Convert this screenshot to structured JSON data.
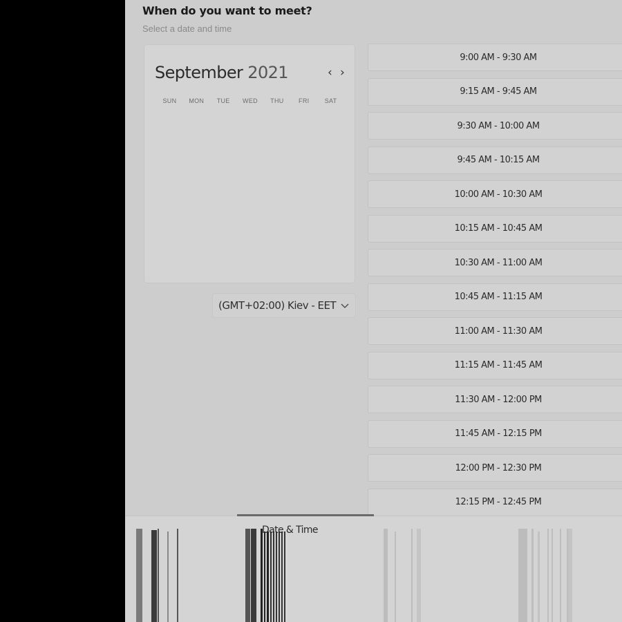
{
  "header": {
    "title": "When do you want to meet?",
    "subtitle": "Select a date and time"
  },
  "calendar": {
    "month": "September",
    "year": "2021",
    "prev_icon": "chevron-left-icon",
    "next_icon": "chevron-right-icon",
    "weekdays": [
      "SUN",
      "MON",
      "TUE",
      "WED",
      "THU",
      "FRI",
      "SAT"
    ]
  },
  "timezone": {
    "selected": "(GMT+02:00) Kiev - EET",
    "icon": "chevron-down-icon"
  },
  "time_slots": [
    "9:00 AM - 9:30 AM",
    "9:15 AM - 9:45 AM",
    "9:30 AM - 10:00 AM",
    "9:45 AM - 10:15 AM",
    "10:00 AM - 10:30 AM",
    "10:15 AM - 10:45 AM",
    "10:30 AM - 11:00 AM",
    "10:45 AM - 11:15 AM",
    "11:00 AM - 11:30 AM",
    "11:15 AM - 11:45 AM",
    "11:30 AM - 12:00 PM",
    "11:45 AM - 12:15 PM",
    "12:00 PM - 12:30 PM",
    "12:15 PM - 12:45 PM"
  ],
  "bottom_nav": {
    "active_tab": "Date & Time",
    "items": [
      {
        "label": "",
        "icon": "service-icon"
      },
      {
        "label": "Date & Time",
        "icon": "calendar-icon"
      },
      {
        "label": "",
        "icon": "details-icon"
      },
      {
        "label": "",
        "icon": "confirm-icon"
      }
    ]
  }
}
